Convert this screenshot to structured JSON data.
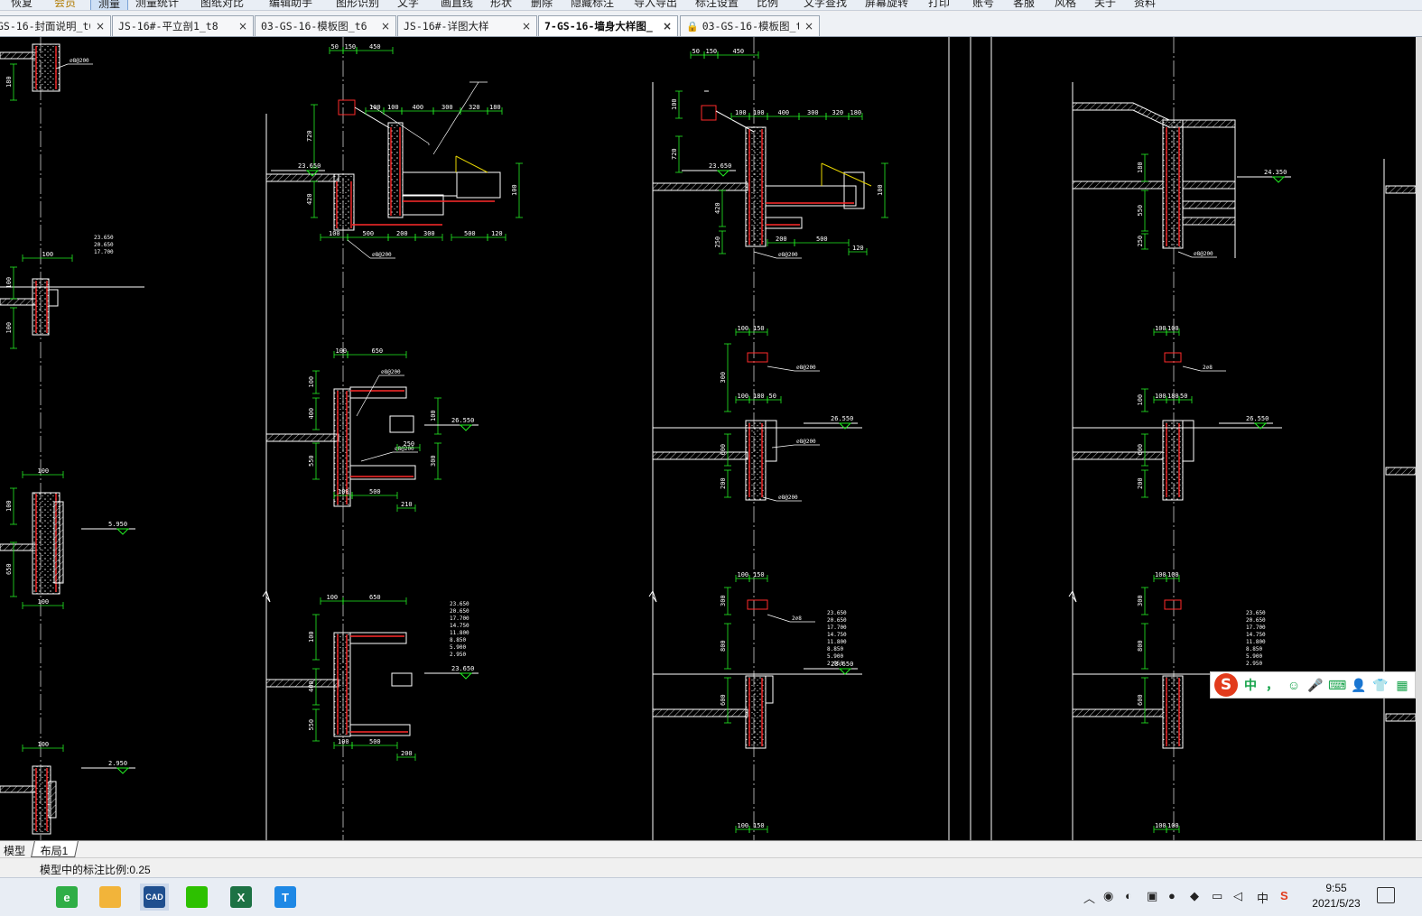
{
  "menubar": {
    "items": [
      "恢复",
      "会员",
      "测量",
      "测量统计",
      "图纸对比",
      "编辑助手",
      "图形识别",
      "文字",
      "画直线",
      "形状",
      "删除",
      "隐藏标注",
      "导入导出",
      "标注设置",
      "比例",
      "文字查找",
      "屏幕旋转",
      "打印",
      "账号",
      "客服",
      "风格",
      "关于",
      "资料"
    ],
    "active_item": "测量"
  },
  "tabs": [
    {
      "label": "GS-16-封面说明_t6",
      "active": false,
      "locked": false
    },
    {
      "label": "JS-16#-平立剖1_t8",
      "active": false,
      "locked": false
    },
    {
      "label": "03-GS-16-模板图_t6",
      "active": false,
      "locked": false
    },
    {
      "label": "JS-16#-详图大样",
      "active": false,
      "locked": false
    },
    {
      "label": "7-GS-16-墙身大样图_",
      "active": true,
      "locked": false
    },
    {
      "label": "03-GS-16-模板图_t6",
      "active": false,
      "locked": true
    }
  ],
  "drawing": {
    "elev_labels": [
      "23.650",
      "26.550",
      "5.950",
      "2.950",
      "24.350",
      "26.550",
      "26.550"
    ],
    "dims": [
      "50",
      "150",
      "450",
      "100",
      "400",
      "300",
      "320",
      "180",
      "720",
      "420",
      "500",
      "200",
      "120",
      "650",
      "400",
      "550",
      "250",
      "210",
      "800",
      "600",
      "100"
    ],
    "elev_stack": [
      "23.650",
      "20.650",
      "17.700",
      "14.750",
      "11.800",
      "8.850",
      "5.900",
      "2.950"
    ]
  },
  "layout_tabs": {
    "model": "模型",
    "layout1": "布局1"
  },
  "status": {
    "text": "模型中的标注比例:0.25"
  },
  "taskbar": {
    "apps": [
      "360-browser-icon",
      "file-explorer-icon",
      "cad-viewer-icon",
      "wechat-icon",
      "excel-icon",
      "tencent-docs-icon"
    ],
    "app_labels": [
      "e",
      "",
      "CAD",
      "",
      "X",
      "T"
    ],
    "colors": {
      "browser": "#2fae46",
      "explorer": "#f2b43a",
      "cad": "#1f4f8f",
      "wechat": "#2dc100",
      "excel": "#1d7244",
      "tdocs": "#1e88e5"
    },
    "ime_indicator": "中",
    "clock_time": "9:55",
    "clock_date": "2021/5/23"
  },
  "ime_bar": {
    "mode": "中",
    "items": [
      "，",
      "☺",
      "🎤",
      "⌨",
      "👤",
      "👕",
      "▦"
    ]
  }
}
